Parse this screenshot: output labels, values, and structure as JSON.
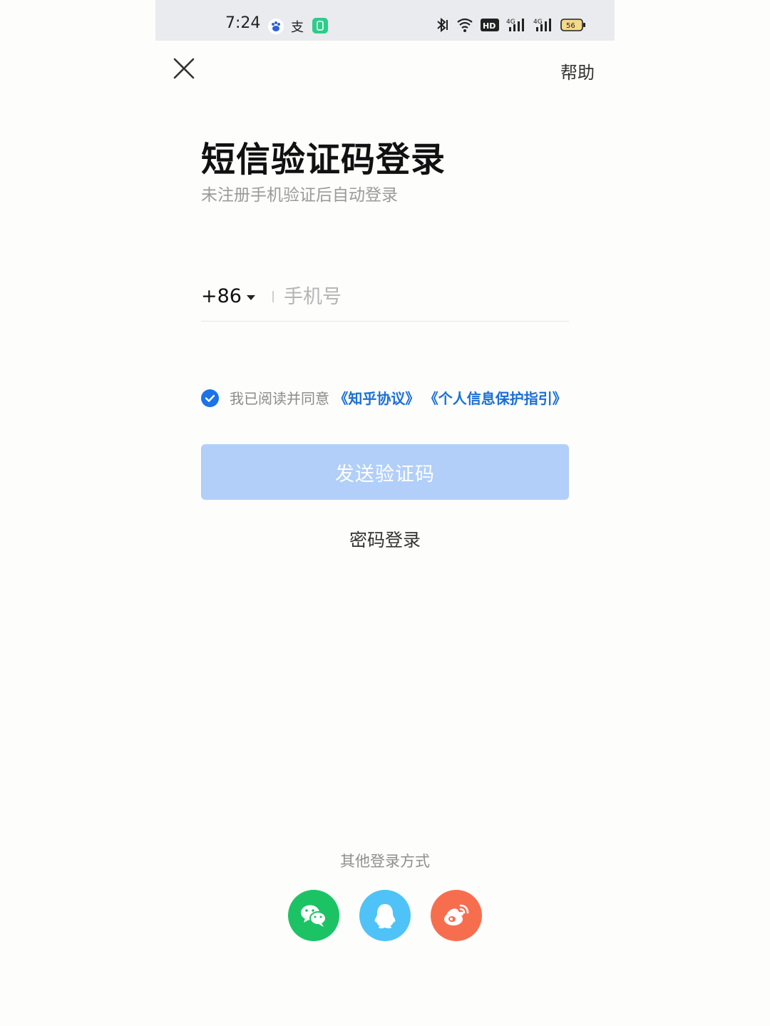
{
  "status_bar": {
    "time": "7:24",
    "battery": "56",
    "network": "4G",
    "hd_label": "HD"
  },
  "header": {
    "close_icon": "close-icon",
    "help_label": "帮助"
  },
  "main": {
    "title": "短信验证码登录",
    "subtitle": "未注册手机验证后自动登录",
    "country_code": "+86",
    "phone_placeholder": "手机号",
    "phone_value": "",
    "agreement": {
      "checked": true,
      "prefix": "我已阅读并同意",
      "link1": "《知乎协议》",
      "link2": "《个人信息保护指引》"
    },
    "send_button": "发送验证码",
    "password_login": "密码登录"
  },
  "footer": {
    "other_label": "其他登录方式",
    "providers": [
      {
        "name": "wechat-icon",
        "color": "#1cc364"
      },
      {
        "name": "qq-icon",
        "color": "#4fc3f7"
      },
      {
        "name": "weibo-icon",
        "color": "#f76e4f"
      }
    ]
  },
  "colors": {
    "accent": "#1a73e8",
    "button_disabled": "#b1cff8"
  }
}
